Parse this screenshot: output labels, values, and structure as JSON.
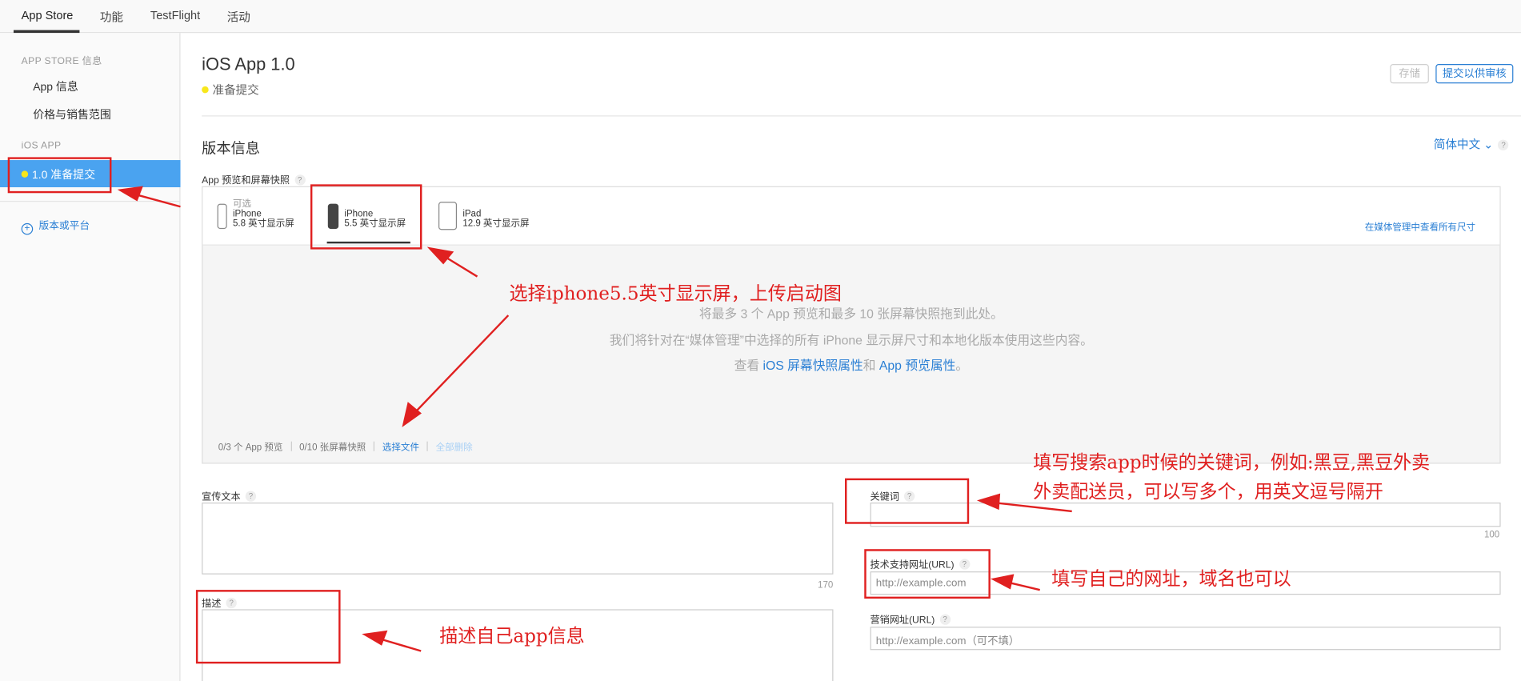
{
  "top_tabs": [
    "App Store",
    "功能",
    "TestFlight",
    "活动"
  ],
  "sidebar": {
    "section1": "APP STORE 信息",
    "item_app_info": "App 信息",
    "item_pricing": "价格与销售范围",
    "section2": "iOS APP",
    "active_item": "1.0 准备提交",
    "add_platform": "版本或平台"
  },
  "header": {
    "title": "iOS App 1.0",
    "status": "准备提交",
    "save": "存储",
    "submit": "提交以供审核"
  },
  "version_info": {
    "title": "版本信息",
    "language": "简体中文 ⌄",
    "preview_label": "App 预览和屏幕快照"
  },
  "devices": [
    {
      "line1": "可选",
      "line2": "iPhone",
      "line3": "5.8 英寸显示屏"
    },
    {
      "line1": "iPhone",
      "line2": "5.5 英寸显示屏"
    },
    {
      "line1": "iPad",
      "line2": "12.9 英寸显示屏"
    }
  ],
  "media": {
    "view_all": "在媒体管理中查看所有尺寸",
    "drop_line1": "将最多 3 个 App 预览和最多 10 张屏幕快照拖到此处。",
    "drop_line2": "我们将针对在“媒体管理”中选择的所有 iPhone 显示屏尺寸和本地化版本使用这些内容。",
    "drop_line3_pre": "查看 ",
    "drop_line3_link1": "iOS 屏幕快照属性",
    "drop_line3_mid": "和 ",
    "drop_line3_link2": "App 预览属性",
    "drop_line3_post": "。",
    "previews_count": "0/3 个 App 预览",
    "screens_count": "0/10 张屏幕快照",
    "choose_file": "选择文件",
    "delete_all": "全部删除"
  },
  "fields": {
    "promo_label": "宣传文本",
    "promo_counter": "170",
    "desc_label": "描述",
    "keywords_label": "关键词",
    "keywords_counter": "100",
    "support_url_label": "技术支持网址(URL)",
    "support_url_placeholder": "http://example.com",
    "marketing_url_label": "营销网址(URL)",
    "marketing_url_placeholder": "http://example.com（可不填）"
  },
  "annotations": {
    "select_iphone": "选择iphone5.5英寸显示屏，上传启动图",
    "keywords_line1": "填写搜索app时候的关键词，例如:黑豆,黑豆外卖",
    "keywords_line2": "外卖配送员，可以写多个，用英文逗号隔开",
    "url_note": "填写自己的网址，域名也可以",
    "desc_note": "描述自己app信息"
  },
  "colors": {
    "accent": "#2a7fd4",
    "sidebar_active": "#4aa3f0",
    "annotation": "#e02020",
    "status_dot": "#f8e71c"
  }
}
